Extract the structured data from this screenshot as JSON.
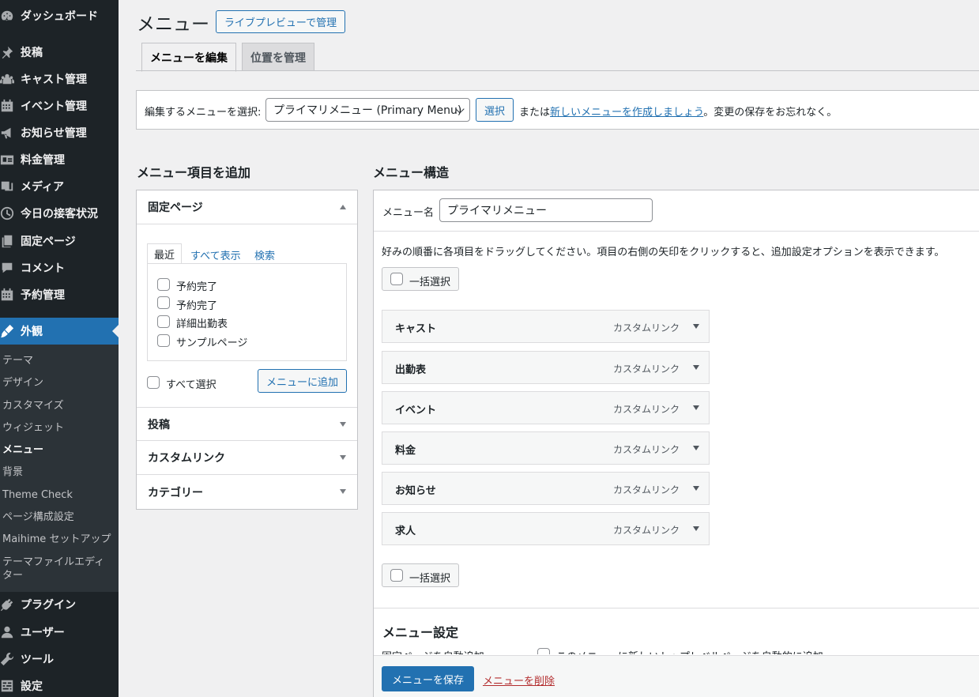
{
  "sidebar": {
    "items": [
      {
        "label": "ダッシュボード",
        "icon": "dashboard-icon"
      },
      {
        "label": "投稿",
        "icon": "pin-icon"
      },
      {
        "label": "キャスト管理",
        "icon": "users-icon"
      },
      {
        "label": "イベント管理",
        "icon": "calendar-icon"
      },
      {
        "label": "お知らせ管理",
        "icon": "megaphone-icon"
      },
      {
        "label": "料金管理",
        "icon": "id-card-icon"
      },
      {
        "label": "メディア",
        "icon": "media-icon"
      },
      {
        "label": "今日の接客状況",
        "icon": "clock-icon"
      },
      {
        "label": "固定ページ",
        "icon": "page-icon"
      },
      {
        "label": "コメント",
        "icon": "comment-icon"
      },
      {
        "label": "予約管理",
        "icon": "calendar-icon"
      },
      {
        "label": "外観",
        "icon": "brush-icon"
      },
      {
        "label": "プラグイン",
        "icon": "plugin-icon"
      },
      {
        "label": "ユーザー",
        "icon": "user-icon"
      },
      {
        "label": "ツール",
        "icon": "wrench-icon"
      },
      {
        "label": "設定",
        "icon": "settings-icon"
      }
    ],
    "submenu": [
      "テーマ",
      "デザイン",
      "カスタマイズ",
      "ウィジェット",
      "メニュー",
      "背景",
      "Theme Check",
      "ページ構成設定",
      "Maihime セットアップ",
      "テーマファイルエディ",
      "ター"
    ]
  },
  "header": {
    "title": "メニュー",
    "live_preview_button": "ライブプレビューで管理",
    "tabs": [
      "メニューを編集",
      "位置を管理"
    ]
  },
  "manage": {
    "label": "編集するメニューを選択:",
    "selected_menu": "プライマリメニュー (Primary Menu)",
    "select_button": "選択",
    "text_before": "または",
    "create_link": "新しいメニューを作成しましょう",
    "text_after": "。変更の保存をお忘れなく。"
  },
  "add_items": {
    "heading": "メニュー項目を追加",
    "pages_title": "固定ページ",
    "tabs": [
      "最近",
      "すべて表示",
      "検索"
    ],
    "pages": [
      "予約完了",
      "予約完了",
      "詳細出勤表",
      "サンプルページ"
    ],
    "select_all": "すべて選択",
    "add_button": "メニューに追加",
    "sections": [
      "投稿",
      "カスタムリンク",
      "カテゴリー"
    ]
  },
  "structure": {
    "heading": "メニュー構造",
    "name_label": "メニュー名",
    "name_value": "プライマリメニュー",
    "instructions": "好みの順番に各項目をドラッグしてください。項目の右側の矢印をクリックすると、追加設定オプションを表示できます。",
    "bulk_select": "一括選択",
    "items": [
      {
        "title": "キャスト",
        "type": "カスタムリンク"
      },
      {
        "title": "出勤表",
        "type": "カスタムリンク"
      },
      {
        "title": "イベント",
        "type": "カスタムリンク"
      },
      {
        "title": "料金",
        "type": "カスタムリンク"
      },
      {
        "title": "お知らせ",
        "type": "カスタムリンク"
      },
      {
        "title": "求人",
        "type": "カスタムリンク"
      }
    ],
    "settings_heading": "メニュー設定",
    "auto_add_label": "固定ページを自動追加",
    "auto_add_option": "このメニューに新しいトップレベルページを自動的に追加",
    "save_button": "メニューを保存",
    "delete_link": "メニューを削除"
  }
}
